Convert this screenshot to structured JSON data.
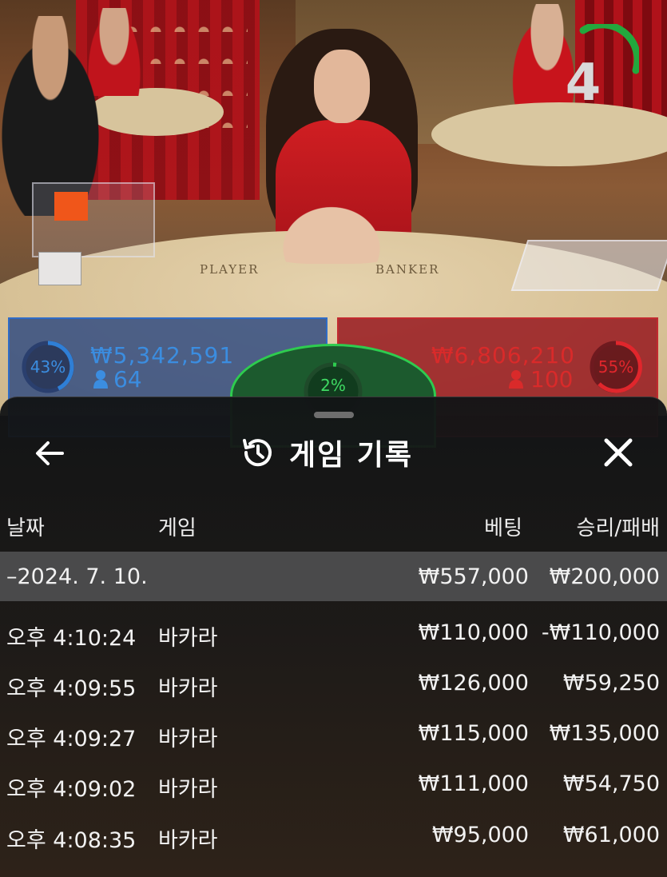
{
  "stream": {
    "countdown": "4",
    "table_labels": {
      "player": "PLAYER",
      "banker": "BANKER"
    }
  },
  "bets": {
    "player": {
      "percent": "43%",
      "amount": "₩5,342,591",
      "players": "64",
      "color": "#2f7fd6",
      "percent_value": 0.43
    },
    "banker": {
      "percent": "55%",
      "amount": "₩6,806,210",
      "players": "100",
      "color": "#d92a2a",
      "percent_value": 0.55
    },
    "tie": {
      "percent": "2%",
      "color": "#2ecc4f"
    }
  },
  "history": {
    "title": "게임 기록",
    "back_icon": "arrow-left-icon",
    "history_icon": "history-clock-icon",
    "close_icon": "close-icon",
    "headers": {
      "date": "날짜",
      "game": "게임",
      "bet": "베팅",
      "result": "승리/패배"
    },
    "date_group": {
      "label": "–2024. 7. 10.",
      "bet": "₩557,000",
      "result": "₩200,000"
    },
    "rows": [
      {
        "time": "오후 4:10:24",
        "game": "바카라",
        "bet": "₩110,000",
        "result": "-₩110,000"
      },
      {
        "time": "오후 4:09:55",
        "game": "바카라",
        "bet": "₩126,000",
        "result": "₩59,250"
      },
      {
        "time": "오후 4:09:27",
        "game": "바카라",
        "bet": "₩115,000",
        "result": "₩135,000"
      },
      {
        "time": "오후 4:09:02",
        "game": "바카라",
        "bet": "₩111,000",
        "result": "₩54,750"
      },
      {
        "time": "오후 4:08:35",
        "game": "바카라",
        "bet": "₩95,000",
        "result": "₩61,000"
      }
    ]
  }
}
